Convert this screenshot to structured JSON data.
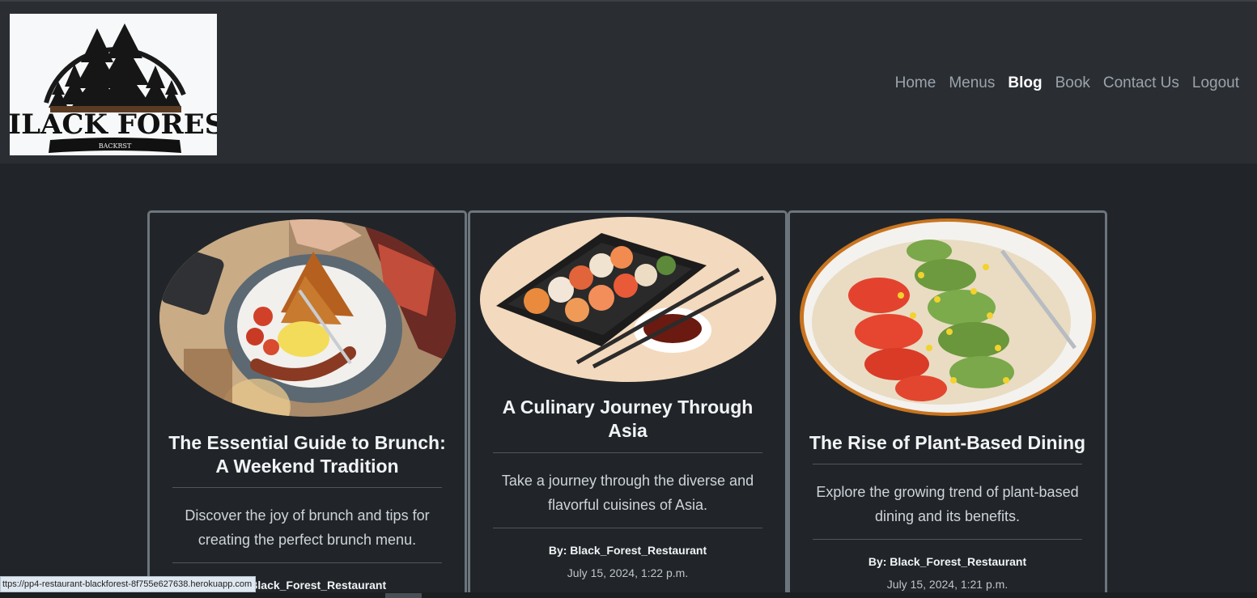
{
  "brand": {
    "logo_line1": "BILACK FOREST",
    "logo_line2": "BACKRST"
  },
  "nav": {
    "items": [
      {
        "label": "Home"
      },
      {
        "label": "Menus"
      },
      {
        "label": "Blog"
      },
      {
        "label": "Book"
      },
      {
        "label": "Contact Us"
      },
      {
        "label": "Logout"
      }
    ],
    "active": "Blog"
  },
  "posts": [
    {
      "title": "The Essential Guide to Brunch: A Weekend Tradition",
      "excerpt": "Discover the joy of brunch and tips for creating the perfect brunch menu.",
      "author": "By: Black_Forest_Restaurant",
      "date": ""
    },
    {
      "title": "A Culinary Journey Through Asia",
      "excerpt": "Take a journey through the diverse and flavorful cuisines of Asia.",
      "author": "By: Black_Forest_Restaurant",
      "date": "July 15, 2024, 1:22 p.m."
    },
    {
      "title": "The Rise of Plant-Based Dining",
      "excerpt": "Explore the growing trend of plant-based dining and its benefits.",
      "author": "By: Black_Forest_Restaurant",
      "date": "July 15, 2024, 1:21 p.m."
    }
  ],
  "status_url": "ttps://pp4-restaurant-blackforest-8f755e627638.herokuapp.com",
  "colors": {
    "page_bg": "#212529",
    "navbar_bg": "#2a2e33",
    "card_border": "#6c757d"
  }
}
